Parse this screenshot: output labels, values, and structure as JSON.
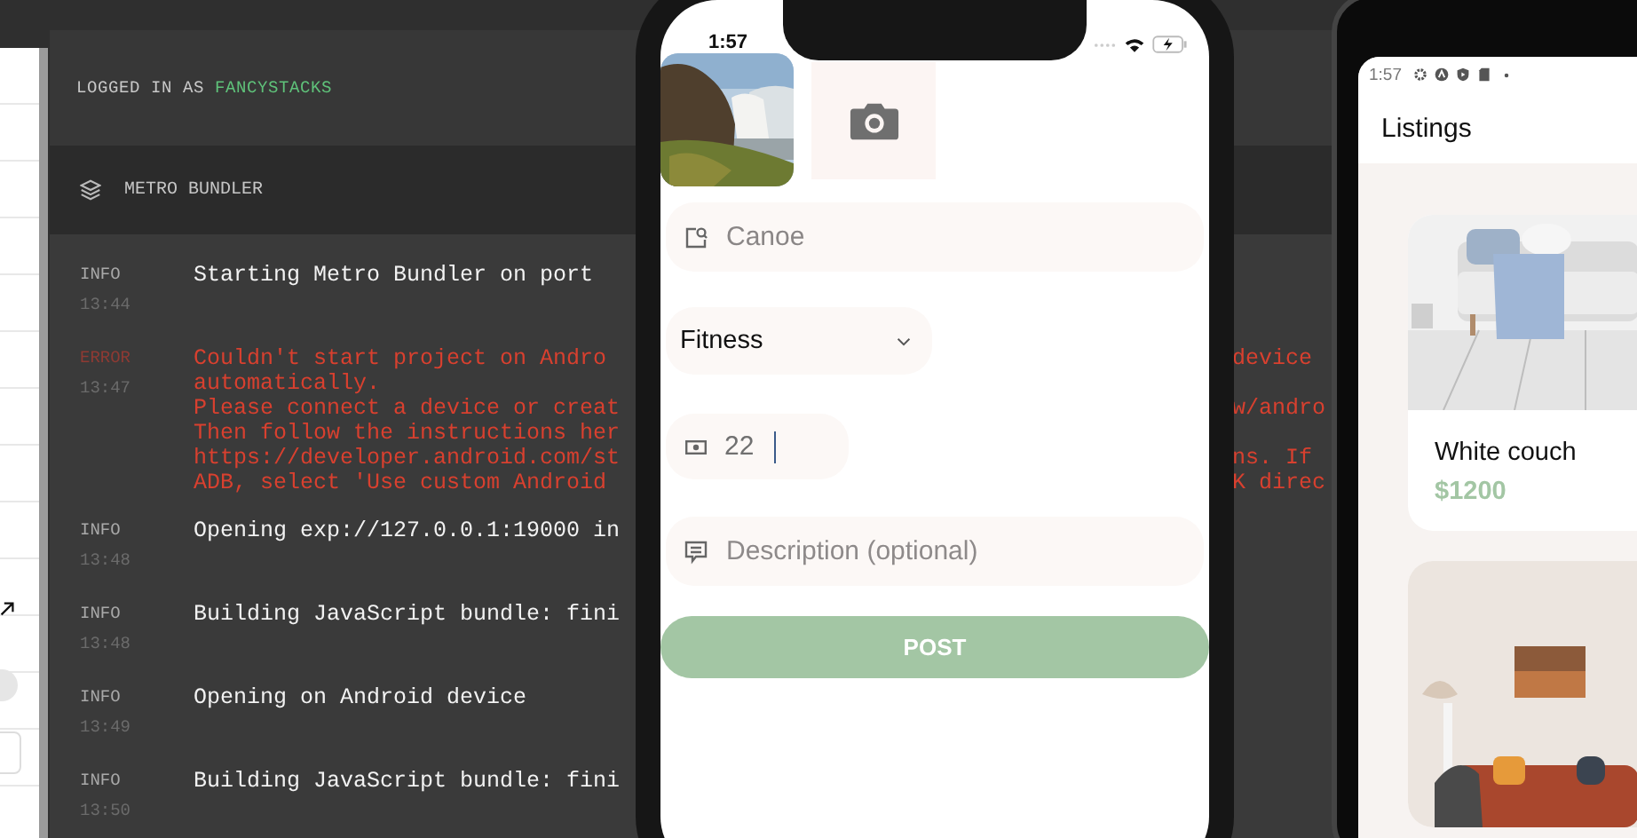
{
  "log_window": {
    "login_label": "LOGGED IN AS",
    "username": "FANCYSTACKS",
    "panel_title": "METRO BUNDLER",
    "entries": [
      {
        "kind": "info",
        "level": "INFO",
        "time": "13:44",
        "lines": [
          {
            "left": "Starting Metro Bundler on port"
          }
        ]
      },
      {
        "kind": "error",
        "level": "ERROR",
        "time": "13:47",
        "lines": [
          {
            "left": "Couldn't start project on Andro",
            "right": "device"
          },
          {
            "left": "automatically."
          },
          {
            "left": "Please connect a device or creat",
            "right": "w/andro"
          },
          {
            "left": "Then follow the instructions her"
          },
          {
            "left": "https://developer.android.com/st",
            "right": "ns. If"
          },
          {
            "left": "ADB, select 'Use custom Android",
            "right": "K direc"
          }
        ]
      },
      {
        "kind": "info",
        "level": "INFO",
        "time": "13:48",
        "lines": [
          {
            "left": "Opening exp://127.0.0.1:19000 in"
          }
        ]
      },
      {
        "kind": "info",
        "level": "INFO",
        "time": "13:48",
        "lines": [
          {
            "left": "Building JavaScript bundle: fini"
          }
        ]
      },
      {
        "kind": "info",
        "level": "INFO",
        "time": "13:49",
        "lines": [
          {
            "left": "Opening on Android device"
          }
        ]
      },
      {
        "kind": "info",
        "level": "INFO",
        "time": "13:50",
        "lines": [
          {
            "left": "Building JavaScript bundle: fini"
          }
        ]
      }
    ]
  },
  "ios_simulator": {
    "status_time": "1:57",
    "form": {
      "title_value": "Canoe",
      "category": "Fitness",
      "price_value": "22",
      "description_placeholder": "Description (optional)",
      "submit": "POST"
    }
  },
  "android_emulator": {
    "status_time": "1:57",
    "screen_title": "Listings",
    "listings": [
      {
        "kind": "picture",
        "title": "White couch",
        "price": "$1200"
      },
      {
        "kind": "picture"
      }
    ]
  }
}
